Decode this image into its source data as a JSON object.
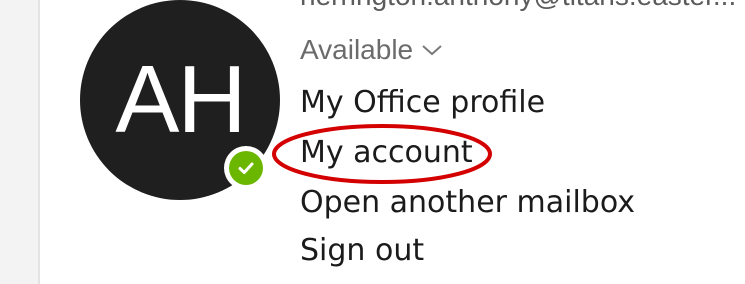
{
  "account": {
    "initials": "AH",
    "email": "herrington.anthony@titans.easter...",
    "presence_status": "Available",
    "presence_color": "#6bb700"
  },
  "menu": {
    "items": [
      {
        "label": "My Office profile"
      },
      {
        "label": "My account"
      },
      {
        "label": "Open another mailbox"
      },
      {
        "label": "Sign out"
      }
    ]
  },
  "annotation": {
    "color": "#d40000",
    "highlighted_item": "My account"
  },
  "icons": {
    "presence": "check-icon",
    "status_dropdown": "chevron-down-icon"
  }
}
